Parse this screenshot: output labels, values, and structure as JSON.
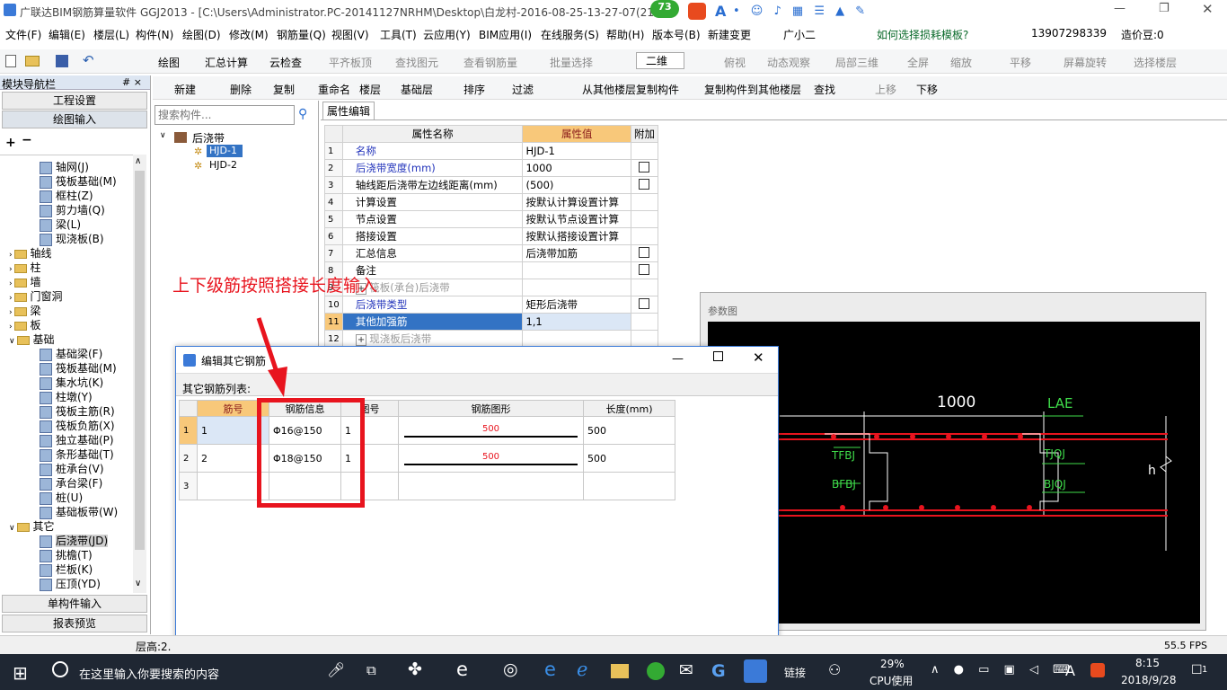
{
  "title": {
    "app": "广联达BIM钢筋算量软件 GGJ2013 - [C:\\Users\\Administrator.PC-20141127NRHM\\Desktop\\白龙村-2016-08-25-13-27-07(210",
    "badge": "73",
    "ime_letter": "A"
  },
  "menubar": {
    "items": [
      "文件(F)",
      "编辑(E)",
      "楼层(L)",
      "构件(N)",
      "绘图(D)",
      "修改(M)",
      "钢筋量(Q)",
      "视图(V)",
      "工具(T)",
      "云应用(Y)",
      "BIM应用(I)",
      "在线服务(S)",
      "帮助(H)",
      "版本号(B)",
      "新建变更",
      "广小二"
    ],
    "question": "如何选择损耗模板?",
    "phone": "13907298339",
    "bean": "造价豆:0"
  },
  "toolbar1": {
    "items": [
      "绘图",
      "汇总计算",
      "云检查",
      "平齐板顶",
      "查找图元",
      "查看钢筋量",
      "批量选择",
      "二维",
      "俯视",
      "动态观察",
      "局部三维",
      "全屏",
      "缩放",
      "平移",
      "屏幕旋转",
      "选择楼层"
    ]
  },
  "toolbar2": {
    "items": [
      "新建",
      "删除",
      "复制",
      "重命名",
      "楼层",
      "基础层",
      "排序",
      "过滤",
      "从其他楼层复制构件",
      "复制构件到其他楼层",
      "查找",
      "上移",
      "下移"
    ]
  },
  "nav": {
    "title": "模块导航栏",
    "pin": "# ×",
    "settings": "工程设置",
    "draw_input": "绘图输入",
    "single_input": "单构件输入",
    "report": "报表预览",
    "tree": [
      {
        "label": "轴网(J)",
        "level": 2
      },
      {
        "label": "筏板基础(M)",
        "level": 2
      },
      {
        "label": "框柱(Z)",
        "level": 2
      },
      {
        "label": "剪力墙(Q)",
        "level": 2
      },
      {
        "label": "梁(L)",
        "level": 2
      },
      {
        "label": "现浇板(B)",
        "level": 2
      },
      {
        "label": "轴线",
        "level": 1
      },
      {
        "label": "柱",
        "level": 1
      },
      {
        "label": "墙",
        "level": 1
      },
      {
        "label": "门窗洞",
        "level": 1
      },
      {
        "label": "梁",
        "level": 1
      },
      {
        "label": "板",
        "level": 1
      },
      {
        "label": "基础",
        "level": 1,
        "open": true
      },
      {
        "label": "基础梁(F)",
        "level": 2
      },
      {
        "label": "筏板基础(M)",
        "level": 2
      },
      {
        "label": "集水坑(K)",
        "level": 2
      },
      {
        "label": "柱墩(Y)",
        "level": 2
      },
      {
        "label": "筏板主筋(R)",
        "level": 2
      },
      {
        "label": "筏板负筋(X)",
        "level": 2
      },
      {
        "label": "独立基础(P)",
        "level": 2
      },
      {
        "label": "条形基础(T)",
        "level": 2
      },
      {
        "label": "桩承台(V)",
        "level": 2
      },
      {
        "label": "承台梁(F)",
        "level": 2
      },
      {
        "label": "桩(U)",
        "level": 2
      },
      {
        "label": "基础板带(W)",
        "level": 2
      },
      {
        "label": "其它",
        "level": 1,
        "open": true
      },
      {
        "label": "后浇带(JD)",
        "level": 2,
        "selected": true
      },
      {
        "label": "挑檐(T)",
        "level": 2
      },
      {
        "label": "栏板(K)",
        "level": 2
      },
      {
        "label": "压顶(YD)",
        "level": 2
      }
    ]
  },
  "component": {
    "search_placeholder": "搜索构件...",
    "root": "后浇带",
    "items": [
      "HJD-1",
      "HJD-2"
    ]
  },
  "props": {
    "tab": "属性编辑",
    "headers": [
      "属性名称",
      "属性值",
      "附加"
    ],
    "rows": [
      {
        "n": "1",
        "name": "名称",
        "value": "HJD-1",
        "cb": false,
        "blue": true
      },
      {
        "n": "2",
        "name": "后浇带宽度(mm)",
        "value": "1000",
        "cb": true,
        "blue": true
      },
      {
        "n": "3",
        "name": "轴线距后浇带左边线距离(mm)",
        "value": "(500)",
        "cb": true
      },
      {
        "n": "4",
        "name": "计算设置",
        "value": "按默认计算设置计算",
        "cb": false
      },
      {
        "n": "5",
        "name": "节点设置",
        "value": "按默认节点设置计算",
        "cb": false
      },
      {
        "n": "6",
        "name": "搭接设置",
        "value": "按默认搭接设置计算",
        "cb": false
      },
      {
        "n": "7",
        "name": "汇总信息",
        "value": "后浇带加筋",
        "cb": true
      },
      {
        "n": "8",
        "name": "备注",
        "value": "",
        "cb": true
      },
      {
        "n": "9",
        "name": "筏板(承台)后浇带",
        "value": "",
        "cb": false,
        "gray": true
      },
      {
        "n": "10",
        "name": "后浇带类型",
        "value": "矩形后浇带",
        "cb": true,
        "blue": true
      },
      {
        "n": "11",
        "name": "其他加强筋",
        "value": "1,1",
        "cb": false,
        "sel": true
      },
      {
        "n": "12",
        "name": "现浇板后浇带",
        "value": "",
        "cb": false,
        "gray": true
      }
    ]
  },
  "annotation": "上下级筋按照搭接长度输入",
  "param_panel": {
    "title": "参数图",
    "width_label": "1000",
    "lae": "LAE",
    "tfbj": "TFBJ",
    "bfbj": "BFBJ",
    "tjqj": "TJQJ",
    "bjqj": "BJQJ",
    "h": "h"
  },
  "dialog": {
    "title": "编辑其它钢筋",
    "list_label": "其它钢筋列表:",
    "headers": [
      "筋号",
      "钢筋信息",
      "图号",
      "钢筋图形",
      "长度(mm)"
    ],
    "rows": [
      {
        "n": "1",
        "jh": "1",
        "info": "Φ16@150",
        "tuhao": "1",
        "shape": "500",
        "len": "500"
      },
      {
        "n": "2",
        "jh": "2",
        "info": "Φ18@150",
        "tuhao": "1",
        "shape": "500",
        "len": "500"
      },
      {
        "n": "3",
        "jh": "",
        "info": "",
        "tuhao": "",
        "shape": "",
        "len": ""
      }
    ]
  },
  "status": {
    "floor": "层高:2.",
    "fps": "55.5 FPS"
  },
  "taskbar": {
    "search": "在这里输入你要搜索的内容",
    "link": "链接",
    "cpu_pct": "29%",
    "cpu_label": "CPU使用",
    "ime": "A",
    "time": "8:15",
    "date": "2018/9/28",
    "notif": "1"
  },
  "colors": {
    "accent": "#3b7ad8",
    "annotation": "#e8141e",
    "selected": "#3373c4"
  }
}
